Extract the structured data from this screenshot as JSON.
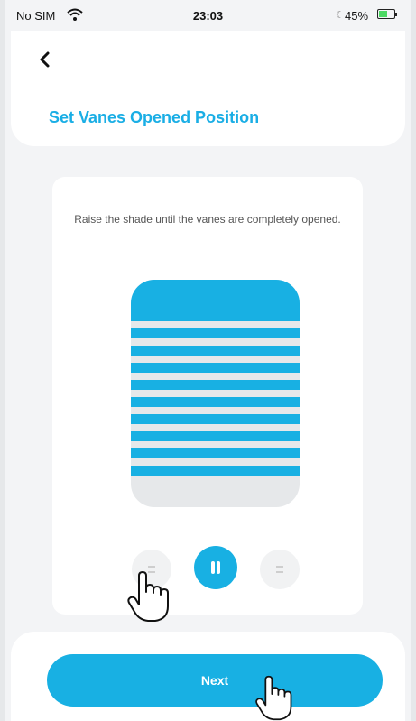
{
  "status_bar": {
    "carrier": "No SIM",
    "time": "23:03",
    "battery_percent": "45%",
    "icons": [
      "wifi-icon",
      "moon-icon",
      "battery-charging-icon"
    ]
  },
  "header": {
    "back_icon": "chevron-left-icon",
    "title": "Set Vanes Opened Position"
  },
  "card": {
    "instruction": "Raise the shade until the vanes are completely opened.",
    "controls": {
      "left_icon": "lines-icon",
      "center_icon": "pause-icon",
      "right_icon": "lines-icon"
    }
  },
  "footer": {
    "next_label": "Next"
  },
  "colors": {
    "accent": "#18b0e3",
    "title": "#1aaee5",
    "background": "#f3f4f6"
  }
}
